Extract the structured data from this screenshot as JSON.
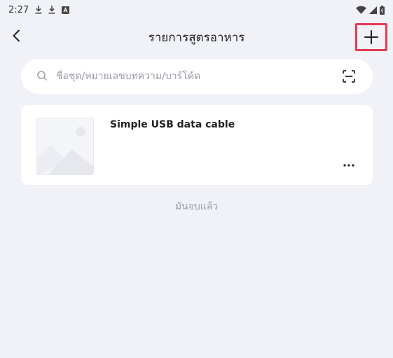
{
  "status_bar": {
    "time": "2:27",
    "left_icons": [
      "download-icon",
      "download-icon",
      "app-notification-icon"
    ],
    "right_icons": [
      "wifi-icon",
      "signal-icon",
      "battery-icon"
    ]
  },
  "header": {
    "title": "รายการสูตรอาหาร",
    "back_icon": "chevron-left-icon",
    "add_icon": "plus-icon",
    "highlight_color": "#e53b52"
  },
  "search": {
    "placeholder": "ชื่อชุด/หมายเลขบทความ/บาร์โค้ด",
    "value": "",
    "scan_icon": "scan-icon"
  },
  "items": [
    {
      "name": "Simple USB data cable",
      "image": "image-placeholder-icon",
      "more": "more-icon"
    }
  ],
  "footer": {
    "end_text": "มันจบแล้ว"
  },
  "colors": {
    "background": "#f0f2f7",
    "card": "#ffffff",
    "muted_text": "#9a9da6"
  }
}
